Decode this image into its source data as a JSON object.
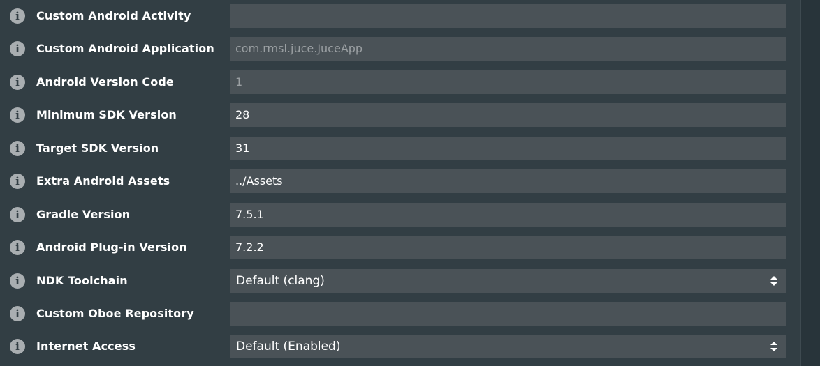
{
  "fields": [
    {
      "label": "Custom Android Activity",
      "value": "",
      "kind": "text"
    },
    {
      "label": "Custom Android Application",
      "value": "com.rmsl.juce.JuceApp",
      "kind": "placeholder"
    },
    {
      "label": "Android Version Code",
      "value": "1",
      "kind": "placeholder"
    },
    {
      "label": "Minimum SDK Version",
      "value": "28",
      "kind": "text"
    },
    {
      "label": "Target SDK Version",
      "value": "31",
      "kind": "text"
    },
    {
      "label": "Extra Android Assets",
      "value": "../Assets",
      "kind": "text"
    },
    {
      "label": "Gradle Version",
      "value": "7.5.1",
      "kind": "text"
    },
    {
      "label": "Android Plug-in Version",
      "value": "7.2.2",
      "kind": "text"
    },
    {
      "label": "NDK Toolchain",
      "value": "Default (clang)",
      "kind": "select"
    },
    {
      "label": "Custom Oboe Repository",
      "value": "",
      "kind": "text"
    },
    {
      "label": "Internet Access",
      "value": "Default (Enabled)",
      "kind": "select"
    }
  ],
  "info_icon": {
    "glyph": "i",
    "icon": "info-icon"
  },
  "colors": {
    "background": "#323e44",
    "field_background": "#4a5257",
    "label_text": "#ffffff",
    "placeholder_text": "#9a9fa2",
    "info_icon": "#a9aeb1"
  }
}
